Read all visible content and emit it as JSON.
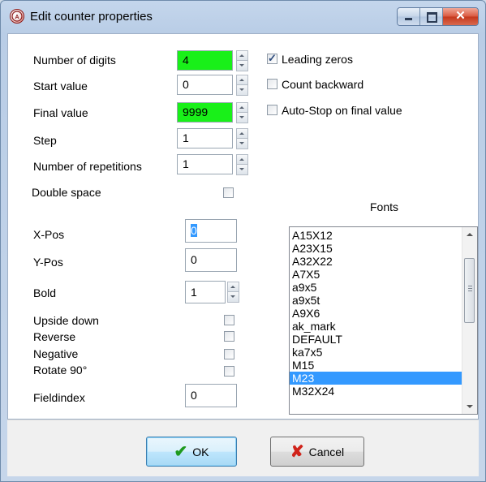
{
  "window": {
    "title": "Edit counter properties"
  },
  "fields": {
    "number_of_digits": {
      "label": "Number of digits",
      "value": "4"
    },
    "start_value": {
      "label": "Start value",
      "value": "0"
    },
    "final_value": {
      "label": "Final value",
      "value": "9999"
    },
    "step": {
      "label": "Step",
      "value": "1"
    },
    "repetitions": {
      "label": "Number of repetitions",
      "value": "1"
    },
    "double_space": {
      "label": "Double space"
    },
    "x_pos": {
      "label": "X-Pos",
      "value": "0"
    },
    "y_pos": {
      "label": "Y-Pos",
      "value": "0"
    },
    "bold": {
      "label": "Bold",
      "value": "1"
    },
    "upside_down": {
      "label": "Upside down"
    },
    "reverse": {
      "label": "Reverse"
    },
    "negative": {
      "label": "Negative"
    },
    "rotate90": {
      "label": "Rotate 90°"
    },
    "fieldindex": {
      "label": "Fieldindex",
      "value": "0"
    }
  },
  "options": {
    "leading_zeros": {
      "label": "Leading zeros",
      "checked": true
    },
    "count_backward": {
      "label": "Count backward",
      "checked": false
    },
    "auto_stop": {
      "label": "Auto-Stop on final value",
      "checked": false
    }
  },
  "fonts": {
    "label": "Fonts",
    "items": [
      "A15X12",
      "A23X15",
      "A32X22",
      "A7X5",
      "a9x5",
      "a9x5t",
      "A9X6",
      "ak_mark",
      "DEFAULT",
      "ka7x5",
      "M15",
      "M23",
      "M32X24"
    ],
    "selected": "M23"
  },
  "buttons": {
    "ok": "OK",
    "cancel": "Cancel"
  },
  "colors": {
    "highlight_green": "#19f019",
    "selection_blue": "#3399ff"
  }
}
